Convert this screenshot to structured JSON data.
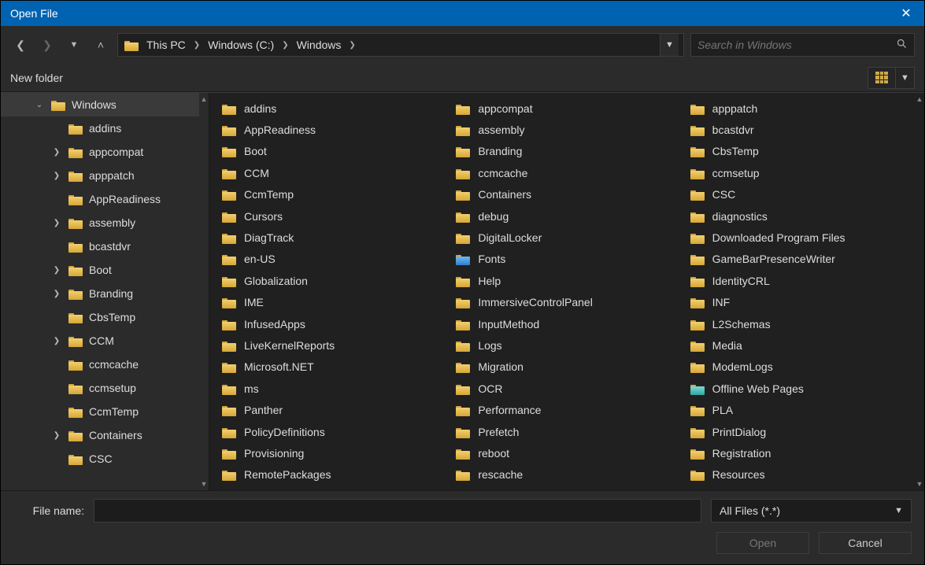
{
  "title": "Open File",
  "nav": {
    "crumbs": [
      "This PC",
      "Windows (C:)",
      "Windows"
    ]
  },
  "search": {
    "placeholder": "Search in Windows"
  },
  "toolbar": {
    "new_folder": "New folder"
  },
  "tree": {
    "items": [
      {
        "label": "Windows",
        "depth": 1,
        "arrow": "down",
        "selected": true
      },
      {
        "label": "addins",
        "depth": 2,
        "arrow": ""
      },
      {
        "label": "appcompat",
        "depth": 2,
        "arrow": "right"
      },
      {
        "label": "apppatch",
        "depth": 2,
        "arrow": "right"
      },
      {
        "label": "AppReadiness",
        "depth": 2,
        "arrow": ""
      },
      {
        "label": "assembly",
        "depth": 2,
        "arrow": "right"
      },
      {
        "label": "bcastdvr",
        "depth": 2,
        "arrow": ""
      },
      {
        "label": "Boot",
        "depth": 2,
        "arrow": "right"
      },
      {
        "label": "Branding",
        "depth": 2,
        "arrow": "right"
      },
      {
        "label": "CbsTemp",
        "depth": 2,
        "arrow": ""
      },
      {
        "label": "CCM",
        "depth": 2,
        "arrow": "right"
      },
      {
        "label": "ccmcache",
        "depth": 2,
        "arrow": ""
      },
      {
        "label": "ccmsetup",
        "depth": 2,
        "arrow": ""
      },
      {
        "label": "CcmTemp",
        "depth": 2,
        "arrow": ""
      },
      {
        "label": "Containers",
        "depth": 2,
        "arrow": "right"
      },
      {
        "label": "CSC",
        "depth": 2,
        "arrow": ""
      }
    ]
  },
  "files": {
    "columns": [
      [
        "addins",
        "AppReadiness",
        "Boot",
        "CCM",
        "CcmTemp",
        "Cursors",
        "DiagTrack",
        "en-US",
        "Globalization",
        "IME",
        "InfusedApps",
        "LiveKernelReports",
        "Microsoft.NET",
        "ms",
        "Panther",
        "PolicyDefinitions",
        "Provisioning",
        "RemotePackages"
      ],
      [
        "appcompat",
        "assembly",
        "Branding",
        "ccmcache",
        "Containers",
        "debug",
        "DigitalLocker",
        "Fonts",
        "Help",
        "ImmersiveControlPanel",
        "InputMethod",
        "Logs",
        "Migration",
        "OCR",
        "Performance",
        "Prefetch",
        "reboot",
        "rescache"
      ],
      [
        "apppatch",
        "bcastdvr",
        "CbsTemp",
        "ccmsetup",
        "CSC",
        "diagnostics",
        "Downloaded Program Files",
        "GameBarPresenceWriter",
        "IdentityCRL",
        "INF",
        "L2Schemas",
        "Media",
        "ModemLogs",
        "Offline Web Pages",
        "PLA",
        "PrintDialog",
        "Registration",
        "Resources"
      ]
    ]
  },
  "footer": {
    "filename_label": "File name:",
    "filter": "All Files (*.*)",
    "open": "Open",
    "cancel": "Cancel"
  }
}
